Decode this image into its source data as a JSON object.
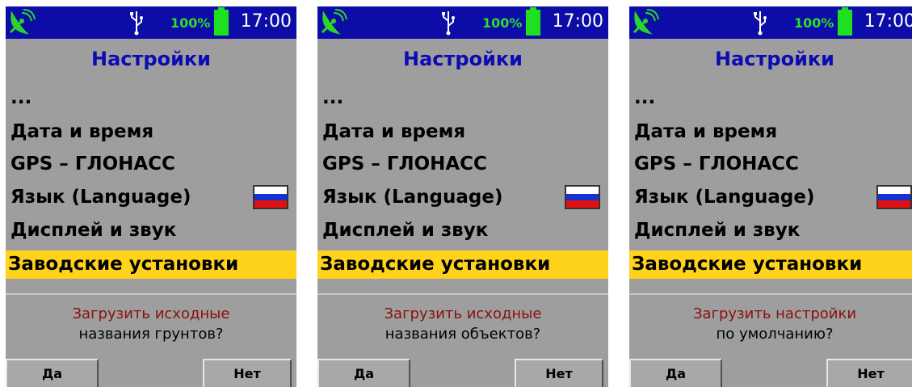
{
  "colors": {
    "status_bar": "#0c0ca6",
    "screen_bg": "#9e9e9e",
    "title": "#0c0cb4",
    "selected_bg": "#ffd21c",
    "battery": "#1fe01f",
    "dialog_question": "#8a0f0f"
  },
  "screens": [
    {
      "status": {
        "satellite_icon": "satellite-dish-icon",
        "usb_icon": "usb-icon",
        "battery_percent": "100%",
        "time": "17:00"
      },
      "title": "Настройки",
      "menu": {
        "ellipsis": "...",
        "date_time": "Дата и время",
        "gps": "GPS – ГЛОНАСС",
        "language": "Язык (Language)",
        "display_sound": "Дисплей и звук",
        "factory": "Заводские установки"
      },
      "language_flag": "russia-flag-icon",
      "dialog": {
        "line1": "Загрузить исходные",
        "line2": "названия грунтов?",
        "yes": "Да",
        "no": "Нет"
      }
    },
    {
      "status": {
        "satellite_icon": "satellite-dish-icon",
        "usb_icon": "usb-icon",
        "battery_percent": "100%",
        "time": "17:00"
      },
      "title": "Настройки",
      "menu": {
        "ellipsis": "...",
        "date_time": "Дата и время",
        "gps": "GPS – ГЛОНАСС",
        "language": "Язык (Language)",
        "display_sound": "Дисплей и звук",
        "factory": "Заводские установки"
      },
      "language_flag": "russia-flag-icon",
      "dialog": {
        "line1": "Загрузить исходные",
        "line2": "названия объектов?",
        "yes": "Да",
        "no": "Нет"
      }
    },
    {
      "status": {
        "satellite_icon": "satellite-dish-icon",
        "usb_icon": "usb-icon",
        "battery_percent": "100%",
        "time": "17:00"
      },
      "title": "Настройки",
      "menu": {
        "ellipsis": "...",
        "date_time": "Дата и время",
        "gps": "GPS – ГЛОНАСС",
        "language": "Язык (Language)",
        "display_sound": "Дисплей и звук",
        "factory": "Заводские установки"
      },
      "language_flag": "russia-flag-icon",
      "dialog": {
        "line1": "Загрузить настройки",
        "line2": "по умолчанию?",
        "yes": "Да",
        "no": "Нет"
      }
    }
  ]
}
